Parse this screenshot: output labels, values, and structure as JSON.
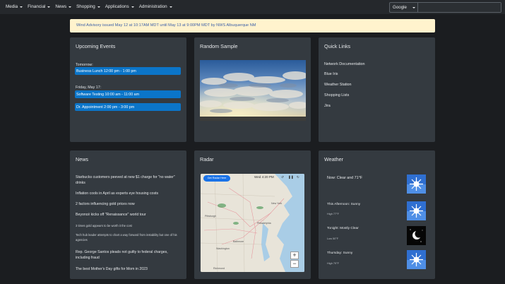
{
  "nav": {
    "items": [
      "Media",
      "Financial",
      "News",
      "Shopping",
      "Applications",
      "Administration"
    ],
    "search_engine": "Google",
    "search_placeholder": ""
  },
  "alert": {
    "text": "Wind Advisory issued May 12 at 10:17AM MDT until May 13 at 9:00PM MDT by NWS Albuquerque NM"
  },
  "events": {
    "title": "Upcoming Events",
    "groups": [
      {
        "day": "Tomorrow:",
        "items": [
          "Business Lunch 12:00 pm - 1:00 pm"
        ]
      },
      {
        "day": "Friday, May 17:",
        "items": [
          "Software Testing 10:00 am - 11:00 am",
          "Dr. Appointment 2:00 pm - 3:00 pm"
        ]
      }
    ]
  },
  "random": {
    "title": "Random Sample"
  },
  "quicklinks": {
    "title": "Quick Links",
    "items": [
      "Network Documentation",
      "Blue Iris",
      "Weather Station",
      "Shopping Lists",
      "Jira"
    ]
  },
  "news": {
    "title": "News",
    "items": [
      "Starbucks customers peeved at new $1 charge for \"no water\" drinks",
      "Inflation cools in April as experts eye housing costs",
      "2 factors influencing gold prices now",
      "Beyoncé kicks off \"Renaissance\" world tour",
      "3 times gold appears to be worth it the cost",
      "Tech hub leader attempts to chart a way forward from instability but one of his agencies",
      "Rep. George Santos pleads not guilty to federal charges, including fraud",
      "The best Mother's Day gifts for Mom in 2023"
    ]
  },
  "radar": {
    "title": "Radar",
    "button": "Get Radar Here",
    "timestamp": "Wed 4:20 PM",
    "zoom_in": "+",
    "zoom_out": "−",
    "places": [
      "Philadelphia",
      "Baltimore",
      "Washington",
      "New York",
      "Richmond",
      "Pittsburgh"
    ]
  },
  "weather": {
    "title": "Weather",
    "items": [
      {
        "title": "Now: Clear and 71°F",
        "sub": "",
        "icon": "clear-day-icon"
      },
      {
        "title": "This Afternoon: Sunny",
        "sub": "High 77°F",
        "icon": "sunny-icon"
      },
      {
        "title": "Tonight: Mostly Clear",
        "sub": "Low 50°F",
        "icon": "clear-night-icon"
      },
      {
        "title": "Thursday: Sunny",
        "sub": "High 79°F",
        "icon": "sunny-icon"
      }
    ]
  }
}
